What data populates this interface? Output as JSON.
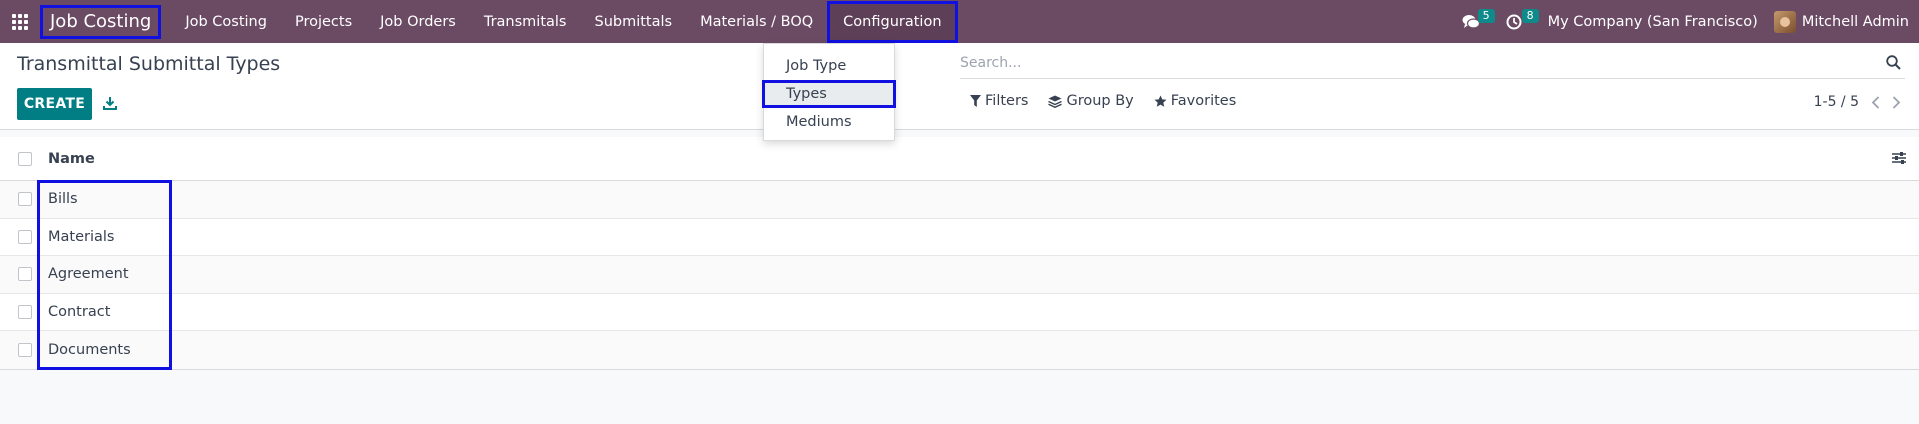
{
  "navbar": {
    "brand": "Job Costing",
    "menu": [
      "Job Costing",
      "Projects",
      "Job Orders",
      "Transmitals",
      "Submittals",
      "Materials / BOQ",
      "Configuration"
    ],
    "messages_count": "5",
    "activities_count": "8",
    "company": "My Company (San Francisco)",
    "user": "Mitchell Admin"
  },
  "control_panel": {
    "title": "Transmittal Submittal Types",
    "create_label": "CREATE",
    "search_placeholder": "Search...",
    "filters_label": "Filters",
    "groupby_label": "Group By",
    "favorites_label": "Favorites",
    "pager": "1-5 / 5"
  },
  "dropdown": {
    "items": [
      "Job Type",
      "Types",
      "Mediums"
    ]
  },
  "list": {
    "header": "Name",
    "rows": [
      "Bills",
      "Materials",
      "Agreement",
      "Contract",
      "Documents"
    ]
  },
  "colors": {
    "navbar": "#6b4a64",
    "primary": "#017e84",
    "highlight": "#1010e0"
  }
}
